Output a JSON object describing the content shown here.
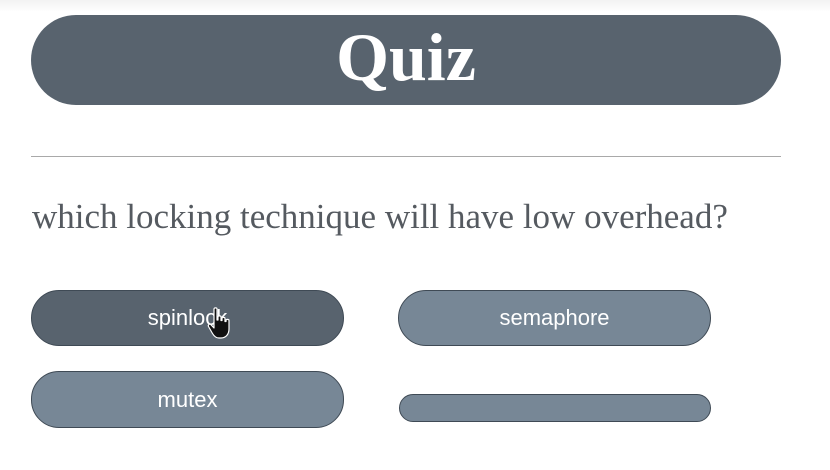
{
  "quiz": {
    "title": "Quiz",
    "question": "which locking technique will have low overhead?",
    "answers": [
      {
        "label": "spinlock",
        "state": "hovered"
      },
      {
        "label": "semaphore",
        "state": "default"
      },
      {
        "label": "mutex",
        "state": "default"
      },
      {
        "label": "",
        "state": "default"
      }
    ]
  },
  "colors": {
    "title_bar": "#58636e",
    "answer_default": "#778796",
    "answer_hovered": "#58636e",
    "question_text": "#555a60",
    "divider": "#a9a9a9"
  },
  "cursor": {
    "icon": "hand-pointer-icon"
  }
}
